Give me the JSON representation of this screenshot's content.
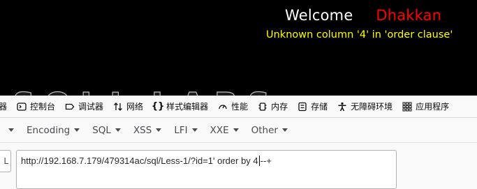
{
  "page": {
    "welcome": "Welcome",
    "name": "Dhakkan",
    "error": "Unknown column '4' in 'order clause'",
    "background_text": "SQLI LABS"
  },
  "devtools": {
    "tabs": [
      {
        "label": "器",
        "icon": "truncated-inspector"
      },
      {
        "label": "控制台",
        "icon": "console-icon"
      },
      {
        "label": "调试器",
        "icon": "debugger-icon"
      },
      {
        "label": "网络",
        "icon": "network-icon"
      },
      {
        "label": "样式编辑器",
        "icon": "style-editor-icon"
      },
      {
        "label": "性能",
        "icon": "performance-icon"
      },
      {
        "label": "内存",
        "icon": "memory-icon"
      },
      {
        "label": "存储",
        "icon": "storage-icon"
      },
      {
        "label": "无障碍环境",
        "icon": "accessibility-icon"
      },
      {
        "label": "应用程序",
        "icon": "application-icon"
      }
    ]
  },
  "hackbar": {
    "menu": [
      "Encoding",
      "SQL",
      "XSS",
      "LFI",
      "XXE",
      "Other"
    ],
    "load_button_fragment": "L",
    "url_before_cursor": "http://192.168.7.179/479314ac/sql/Less-1/?id=1' order by 4",
    "url_after_cursor": "--+"
  },
  "colors": {
    "page_bg": "#000000",
    "welcome": "#ffffff",
    "name": "#ff0000",
    "error": "#ffff00",
    "toolbar_bg": "#f9f9fa"
  }
}
